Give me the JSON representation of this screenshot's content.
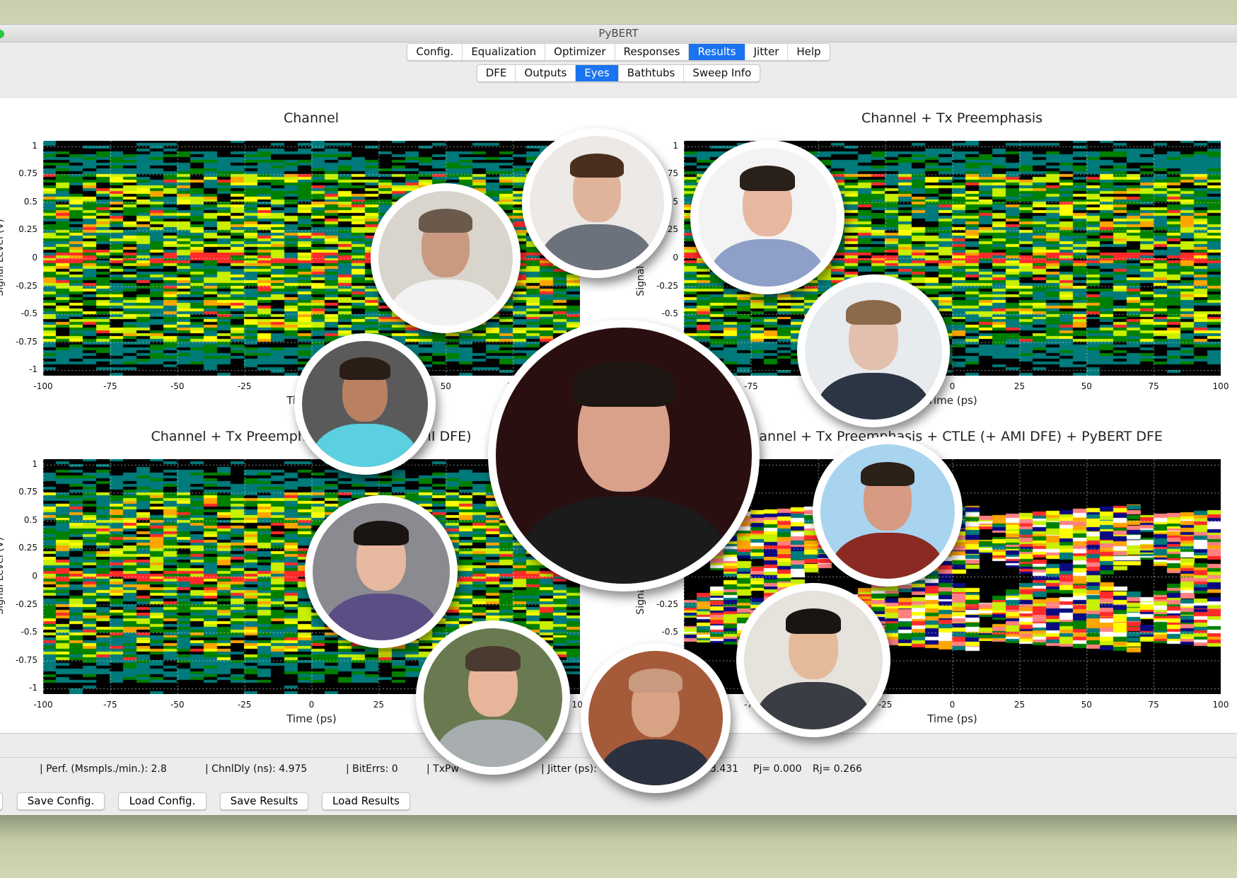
{
  "window": {
    "title": "PyBERT"
  },
  "tabs": [
    {
      "label": "Config.",
      "active": false
    },
    {
      "label": "Equalization",
      "active": false
    },
    {
      "label": "Optimizer",
      "active": false
    },
    {
      "label": "Responses",
      "active": false
    },
    {
      "label": "Results",
      "active": true
    },
    {
      "label": "Jitter",
      "active": false
    },
    {
      "label": "Help",
      "active": false
    }
  ],
  "subtabs": [
    {
      "label": "DFE",
      "active": false
    },
    {
      "label": "Outputs",
      "active": false
    },
    {
      "label": "Eyes",
      "active": true
    },
    {
      "label": "Bathtubs",
      "active": false
    },
    {
      "label": "Sweep Info",
      "active": false
    }
  ],
  "plots": [
    {
      "title": "Channel",
      "ylabel": "Signal Level (V)",
      "xlabel": "Time (ps)",
      "style": "noisy"
    },
    {
      "title": "Channel + Tx Preemphasis",
      "ylabel": "Signal Level (V)",
      "xlabel": "Time (ps)",
      "style": "noisy"
    },
    {
      "title": "Channel + Tx Preemphasis + CTLE (+ AMI DFE)",
      "ylabel": "Signal Level (V)",
      "xlabel": "Time (ps)",
      "style": "noisy"
    },
    {
      "title": "Channel + Tx Preemphasis + CTLE (+ AMI DFE) + PyBERT DFE",
      "ylabel": "Signal Level (V)",
      "xlabel": "Time (ps)",
      "style": "open-eye"
    }
  ],
  "axes": {
    "xticks": [
      "-100",
      "-75",
      "-50",
      "-25",
      "0",
      "25",
      "50",
      "75",
      "100"
    ],
    "yticks": [
      "1",
      "0.75",
      "0.5",
      "0.25",
      "0",
      "-0.25",
      "-0.5",
      "-0.75",
      "-1"
    ],
    "xlim": [
      -100,
      100
    ],
    "ylim": [
      -1.05,
      1.05
    ]
  },
  "colors": {
    "accent": "#1a73f0",
    "heat": [
      "#000000",
      "#007a7a",
      "#008000",
      "#c8f000",
      "#ffff00",
      "#ffa500",
      "#ff2a2a",
      "#ffffff"
    ]
  },
  "status": {
    "perf": "| Perf. (Msmpls./min.):  2.8",
    "chnl_dly": "| ChnlDly (ns):   4.975",
    "bit_errs": "| BitErrs: 0",
    "tx_pwr": "| TxPw",
    "jitter": "| Jitter (ps):",
    "jitter_val": "3.431",
    "pj": "Pj= 0.000",
    "rj": "Rj= 0.266"
  },
  "buttons": {
    "save_config": "Save Config.",
    "load_config": "Load Config.",
    "save_results": "Save Results",
    "load_results": "Load Results"
  },
  "photos": [
    {
      "name": "photo-father-son",
      "bg": "#d9d4cc",
      "skin": "#c99a80",
      "hair": "#6b5a4c",
      "shirt": "#f2f2f2"
    },
    {
      "name": "photo-bearded-man",
      "bg": "#ece9e6",
      "skin": "#e0b49b",
      "hair": "#4a2e1e",
      "shirt": "#6c727c"
    },
    {
      "name": "photo-smiling-man-plaid",
      "bg": "#f3f3f3",
      "skin": "#e7b8a1",
      "hair": "#2a201a",
      "shirt": "#8ea0c8"
    },
    {
      "name": "photo-man-glasses-beard",
      "bg": "#e8ebee",
      "skin": "#e2c0ad",
      "hair": "#8b6a4a",
      "shirt": "#2b3544"
    },
    {
      "name": "photo-man-suit-teal-shirt",
      "bg": "#5a5a5a",
      "skin": "#b98062",
      "hair": "#2a1d16",
      "shirt": "#5ad0e0"
    },
    {
      "name": "photo-man-dark-jacket",
      "bg": "#2a0f10",
      "skin": "#d9a08a",
      "hair": "#1e1612",
      "shirt": "#1b1b1b"
    },
    {
      "name": "photo-mother-daughter",
      "bg": "#8a8a90",
      "skin": "#e6b9a0",
      "hair": "#1a1512",
      "shirt": "#5b4e84"
    },
    {
      "name": "photo-man-red-shirt",
      "bg": "#a8d4f0",
      "skin": "#d79a82",
      "hair": "#2c2018",
      "shirt": "#8a2a22"
    },
    {
      "name": "photo-young-man-scarf",
      "bg": "#e6e2dc",
      "skin": "#e4bb9a",
      "hair": "#1a1512",
      "shirt": "#3a3d44"
    },
    {
      "name": "photo-man-glasses-outdoor",
      "bg": "#6a7a50",
      "skin": "#e8b49a",
      "hair": "#4a3a30",
      "shirt": "#a8aeb0"
    },
    {
      "name": "photo-bald-man-glasses",
      "bg": "#a55a3a",
      "skin": "#d8a284",
      "hair": "#c89a80",
      "shirt": "#2c3140"
    }
  ]
}
